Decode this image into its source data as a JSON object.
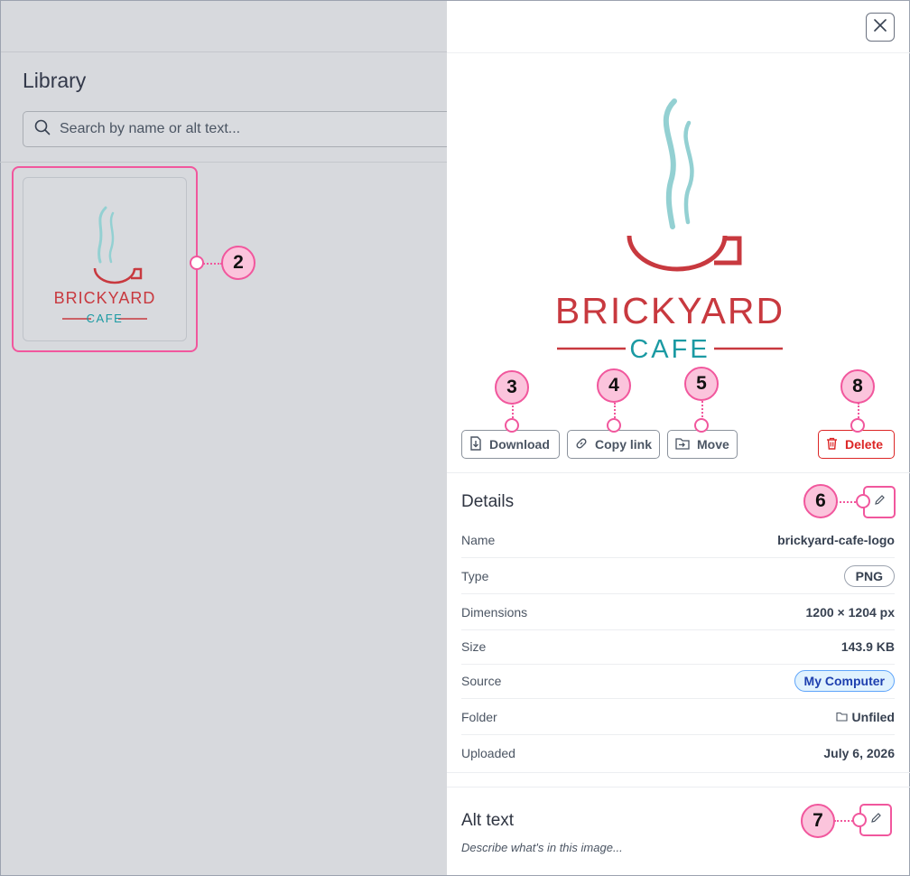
{
  "library": {
    "title": "Library",
    "search_placeholder": "Search by name or alt text...",
    "thumbnail_alt": "brickyard-cafe-logo"
  },
  "logo": {
    "word1": "BRICKYARD",
    "word2": "CAFE",
    "colors": {
      "red": "#c8393f",
      "teal": "#1b9aa3",
      "steam": "#93d0d2"
    }
  },
  "actions": {
    "download": "Download",
    "copy_link": "Copy link",
    "move": "Move",
    "delete": "Delete"
  },
  "details": {
    "title": "Details",
    "rows": [
      {
        "label": "Name",
        "value": "brickyard-cafe-logo"
      },
      {
        "label": "Type",
        "value": "PNG"
      },
      {
        "label": "Dimensions",
        "value": "1200 × 1204 px"
      },
      {
        "label": "Size",
        "value": "143.9 KB"
      },
      {
        "label": "Source",
        "value": "My Computer"
      },
      {
        "label": "Folder",
        "value": "Unfiled"
      },
      {
        "label": "Uploaded",
        "value": "July 6, 2026"
      }
    ]
  },
  "alt_text": {
    "title": "Alt text",
    "placeholder": "Describe what's in this image..."
  },
  "markers": {
    "m2": "2",
    "m3": "3",
    "m4": "4",
    "m5": "5",
    "m6": "6",
    "m7": "7",
    "m8": "8"
  },
  "theme": {
    "callout": "#f1579d",
    "callout_fill": "#fbc4dc",
    "danger": "#dc2626"
  }
}
